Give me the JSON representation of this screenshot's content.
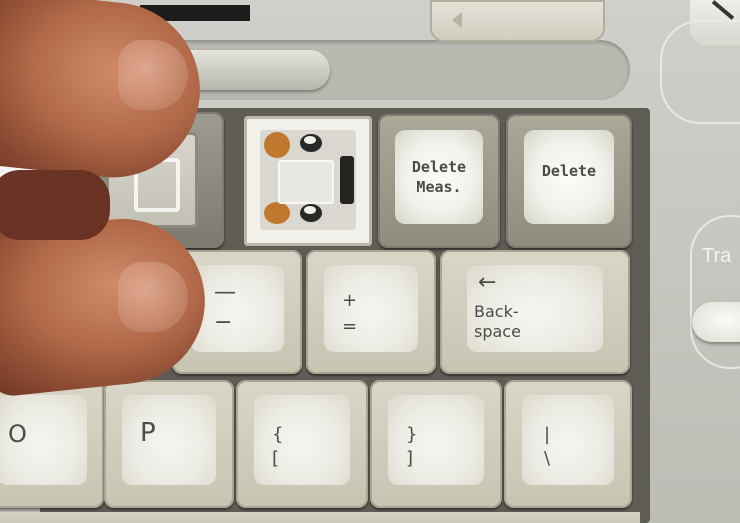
{
  "keys": {
    "delete_meas_line1": "Delete",
    "delete_meas_line2": "Meas.",
    "delete": "Delete",
    "minus_top": "—",
    "minus_bottom": "−",
    "plus_top": "+",
    "equals_bottom": "=",
    "backspace_arrow": "←",
    "backspace_line1": "Back-",
    "backspace_line2": "space",
    "p": "P",
    "o": "O",
    "bracket_top": "{",
    "bracket_bottom": "[",
    "rbracket_top": "}",
    "rbracket_bottom": "]",
    "pipe_top": "|",
    "backslash_bottom": "\\"
  },
  "panel": {
    "tra_label": "Tra"
  },
  "colors": {
    "panel": "#c8c8c1",
    "key_cream": "#d9d6c8",
    "key_gray": "#9d9b8d",
    "skin": "#b06848"
  }
}
